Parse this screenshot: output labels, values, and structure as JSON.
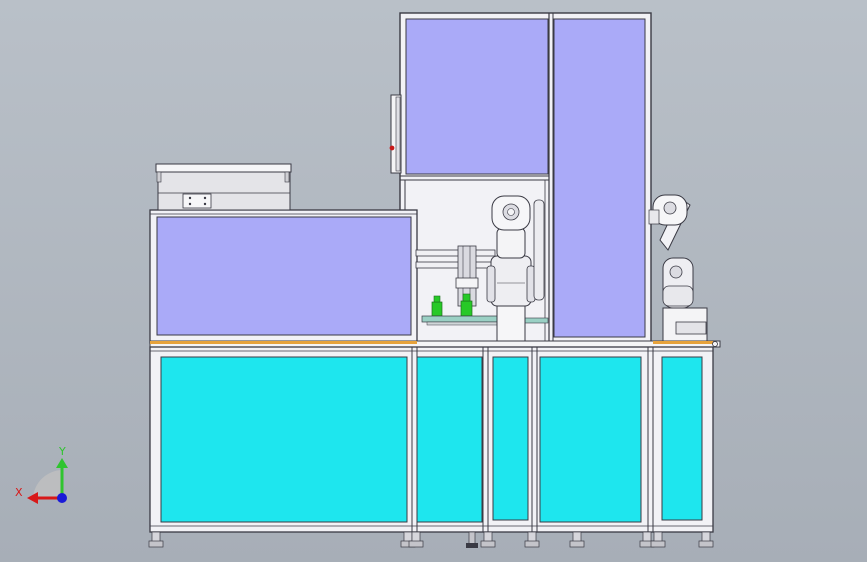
{
  "colors": {
    "background_top": "#b9c0c8",
    "background_bottom": "#a7aeb7",
    "panel_lavender": "#aaaaf8",
    "panel_cyan": "#1ee6ee",
    "frame_light": "#f0f0f4",
    "frame_dark": "#3a3a44",
    "tabletop_orange": "#e6a23c",
    "axis_y_green": "#2fc42f",
    "axis_x_red": "#d81818",
    "axis_z_blue": "#1a1ad8",
    "part_green": "#27c927"
  },
  "triad": {
    "y_label": "Y",
    "x_label": "X"
  },
  "icons": {
    "coordinate_triad": "xyz-axis-triad-icon",
    "robot_center": "six-axis-robot-arm-icon",
    "robot_right": "six-axis-robot-arm-icon"
  }
}
